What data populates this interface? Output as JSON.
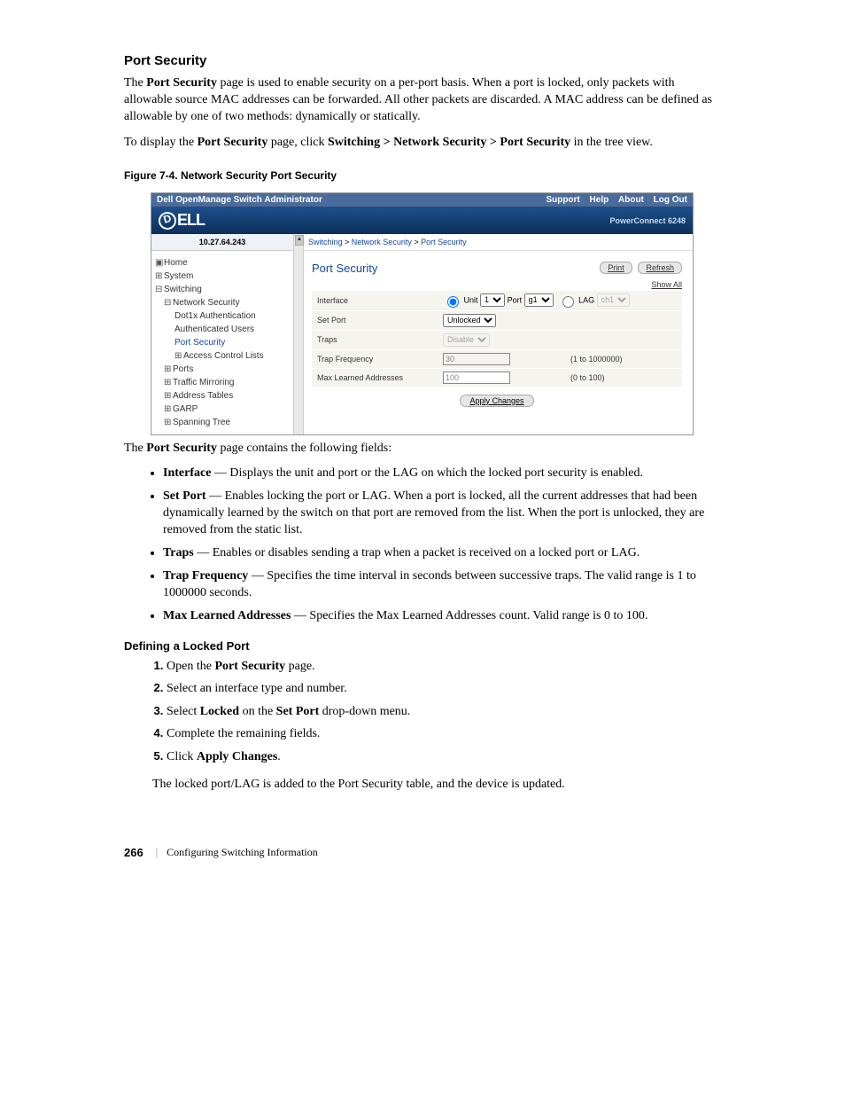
{
  "section": {
    "title": "Port Security",
    "intro_html": "The <b>Port Security</b> page is used to enable security on a per-port basis. When a port is locked, only packets with allowable source MAC addresses can be forwarded. All other packets are discarded. A MAC address can be defined as allowable by one of two methods: dynamically or statically.",
    "nav_html": "To display the <b>Port Security</b> page, click <b>Switching > Network Security > Port Security</b> in the tree view."
  },
  "figure": {
    "caption": "Figure 7-4.    Network Security Port Security"
  },
  "screenshot": {
    "titlebar": "Dell OpenManage Switch Administrator",
    "top_links": [
      "Support",
      "Help",
      "About",
      "Log Out"
    ],
    "product": "PowerConnect 6248",
    "ip": "10.27.64.243",
    "breadcrumb": [
      "Switching",
      "Network Security",
      "Port Security"
    ],
    "panel_title": "Port Security",
    "buttons": {
      "print": "Print",
      "refresh": "Refresh",
      "showall": "Show All",
      "apply": "Apply Changes"
    },
    "tree": {
      "home": "Home",
      "system": "System",
      "switching": "Switching",
      "network_security": "Network Security",
      "dot1x": "Dot1x Authentication",
      "auth_users": "Authenticated Users",
      "port_security": "Port Security",
      "acl": "Access Control Lists",
      "ports": "Ports",
      "traffic": "Traffic Mirroring",
      "address": "Address Tables",
      "garp": "GARP",
      "spanning": "Spanning Tree"
    },
    "fields": {
      "interface": {
        "label": "Interface",
        "unit_label": "Unit",
        "unit_value": "1",
        "port_label": "Port",
        "port_value": "g1",
        "lag_label": "LAG",
        "lag_value": "ch1"
      },
      "set_port": {
        "label": "Set Port",
        "value": "Unlocked"
      },
      "traps": {
        "label": "Traps",
        "value": "Disable"
      },
      "trap_freq": {
        "label": "Trap Frequency",
        "value": "30",
        "hint": "(1 to 1000000)"
      },
      "max_learned": {
        "label": "Max Learned Addresses",
        "value": "100",
        "hint": "(0 to 100)"
      }
    }
  },
  "post_figure": {
    "intro_html": "The <b>Port Security</b> page contains the following fields:",
    "bullets": [
      "<b>Interface</b> — Displays the unit and port or the LAG on which the locked port security is enabled.",
      "<b>Set Port</b> — Enables locking the port or LAG. When a port is locked, all the current addresses that had been dynamically learned by the switch on that port are removed from the list. When the port is unlocked, they are removed from the static list.",
      "<b>Traps</b> — Enables or disables sending a trap when a packet is received on a locked port or LAG.",
      "<b>Trap Frequency</b> — Specifies the time interval in seconds between successive traps. The valid range is 1 to 1000000 seconds.",
      "<b>Max Learned Addresses</b> — Specifies the Max Learned Addresses count. Valid range is 0 to 100."
    ]
  },
  "procedure": {
    "title": "Defining a Locked Port",
    "steps": [
      "Open the <b>Port Security</b> page.",
      "Select an interface type and number.",
      "Select <b>Locked</b> on the <b>Set Port</b> drop-down menu.",
      "Complete the remaining fields.",
      "Click <b>Apply Changes</b>."
    ],
    "result": "The locked port/LAG is added to the Port Security table, and the device is updated."
  },
  "footer": {
    "page": "266",
    "chapter": "Configuring Switching Information"
  }
}
